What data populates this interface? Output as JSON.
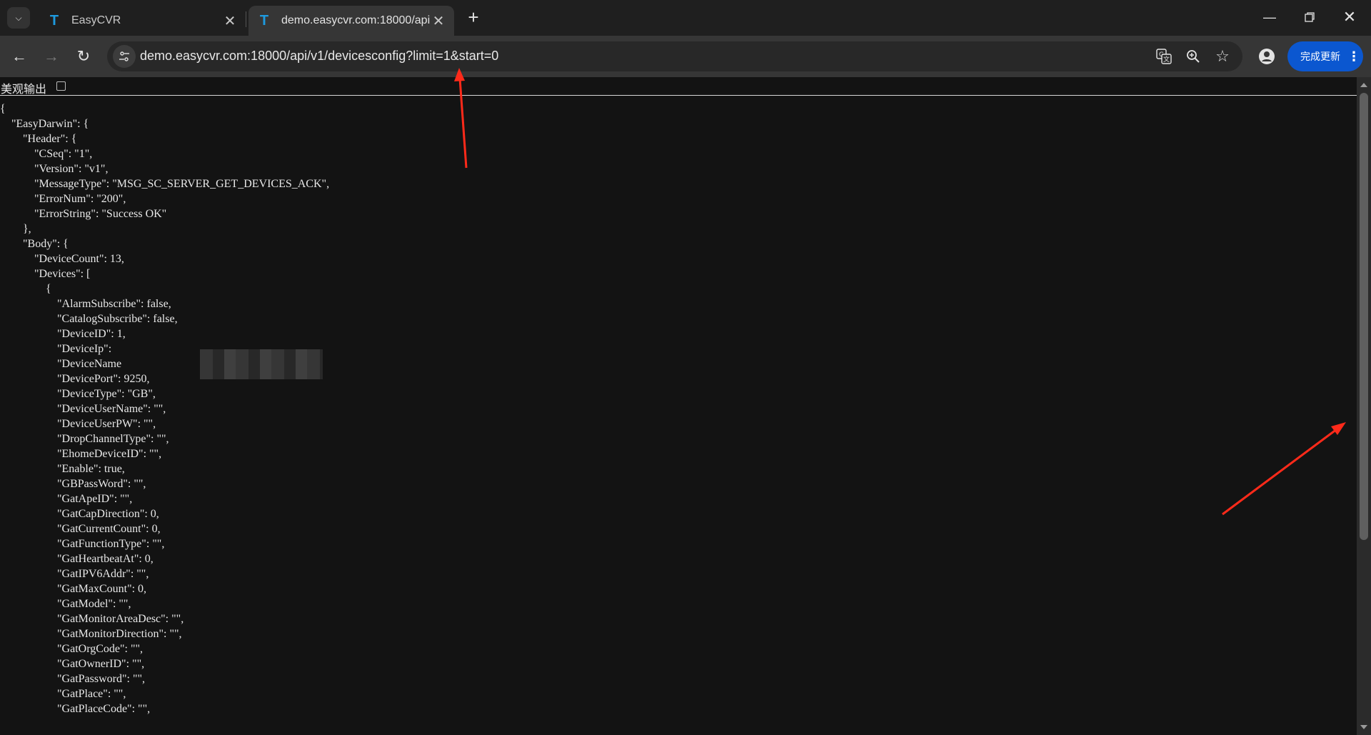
{
  "browser": {
    "tabs": [
      {
        "title": "EasyCVR",
        "active": false
      },
      {
        "title": "demo.easycvr.com:18000/api/v1/devicesconfig?limit=1&start=0",
        "active": true
      }
    ],
    "url": "demo.easycvr.com:18000/api/v1/devicesconfig?limit=1&start=0",
    "update_button_label": "完成更新",
    "favicon_color": "#1e9be0",
    "accent": "#0b57d0"
  },
  "page": {
    "pretty_print_label": "美观输出",
    "pretty_print_checked": false,
    "json_lines": [
      "{",
      "    \"EasyDarwin\": {",
      "        \"Header\": {",
      "            \"CSeq\": \"1\",",
      "            \"Version\": \"v1\",",
      "            \"MessageType\": \"MSG_SC_SERVER_GET_DEVICES_ACK\",",
      "            \"ErrorNum\": \"200\",",
      "            \"ErrorString\": \"Success OK\"",
      "        },",
      "        \"Body\": {",
      "            \"DeviceCount\": 13,",
      "            \"Devices\": [",
      "                {",
      "                    \"AlarmSubscribe\": false,",
      "                    \"CatalogSubscribe\": false,",
      "                    \"DeviceID\": 1,",
      "                    \"DeviceIp\":",
      "                    \"DeviceName",
      "                    \"DevicePort\": 9250,",
      "                    \"DeviceType\": \"GB\",",
      "                    \"DeviceUserName\": \"\",",
      "                    \"DeviceUserPW\": \"\",",
      "                    \"DropChannelType\": \"\",",
      "                    \"EhomeDeviceID\": \"\",",
      "                    \"Enable\": true,",
      "                    \"GBPassWord\": \"\",",
      "                    \"GatApeID\": \"\",",
      "                    \"GatCapDirection\": 0,",
      "                    \"GatCurrentCount\": 0,",
      "                    \"GatFunctionType\": \"\",",
      "                    \"GatHeartbeatAt\": 0,",
      "                    \"GatIPV6Addr\": \"\",",
      "                    \"GatMaxCount\": 0,",
      "                    \"GatModel\": \"\",",
      "                    \"GatMonitorAreaDesc\": \"\",",
      "                    \"GatMonitorDirection\": \"\",",
      "                    \"GatOrgCode\": \"\",",
      "                    \"GatOwnerID\": \"\",",
      "                    \"GatPassword\": \"\",",
      "                    \"GatPlace\": \"\",",
      "                    \"GatPlaceCode\": \"\","
    ]
  }
}
